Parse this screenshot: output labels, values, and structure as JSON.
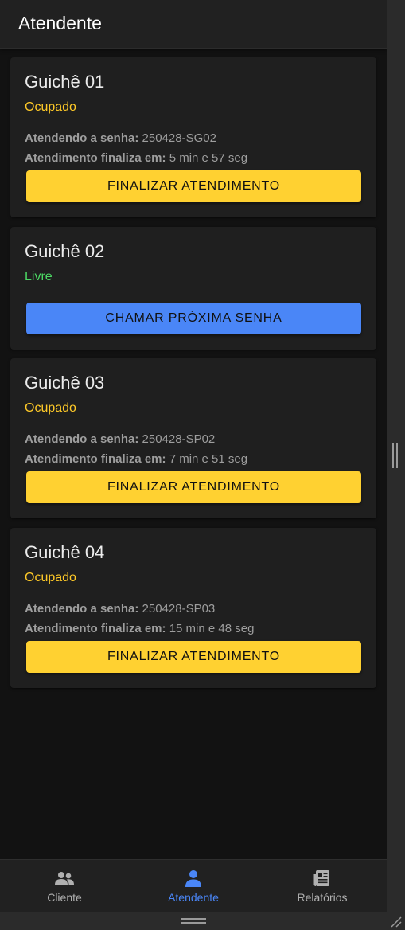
{
  "header": {
    "title": "Atendente"
  },
  "counters": [
    {
      "title": "Guichê 01",
      "status": "Ocupado",
      "ticket_label": "Atendendo a senha:",
      "ticket": "250428-SG02",
      "ends_label": "Atendimento finaliza em:",
      "ends": "5 min e 57 seg",
      "button": "FINALIZAR ATENDIMENTO"
    },
    {
      "title": "Guichê 02",
      "status": "Livre",
      "button": "CHAMAR PRÓXIMA SENHA"
    },
    {
      "title": "Guichê 03",
      "status": "Ocupado",
      "ticket_label": "Atendendo a senha:",
      "ticket": "250428-SP02",
      "ends_label": "Atendimento finaliza em:",
      "ends": "7 min e 51 seg",
      "button": "FINALIZAR ATENDIMENTO"
    },
    {
      "title": "Guichê 04",
      "status": "Ocupado",
      "ticket_label": "Atendendo a senha:",
      "ticket": "250428-SP03",
      "ends_label": "Atendimento finaliza em:",
      "ends": "15 min e 48 seg",
      "button": "FINALIZAR ATENDIMENTO"
    }
  ],
  "bottom_nav": {
    "items": [
      {
        "label": "Cliente",
        "icon": "users-icon",
        "active": false
      },
      {
        "label": "Atendente",
        "icon": "user-icon",
        "active": true
      },
      {
        "label": "Relatórios",
        "icon": "newspaper-icon",
        "active": false
      }
    ]
  },
  "colors": {
    "busy": "#ffca28",
    "free": "#4cd964",
    "finish_button": "#ffd131",
    "call_button": "#4a86f7",
    "nav_active": "#4a86f7",
    "nav_inactive": "#b0b0b0"
  }
}
